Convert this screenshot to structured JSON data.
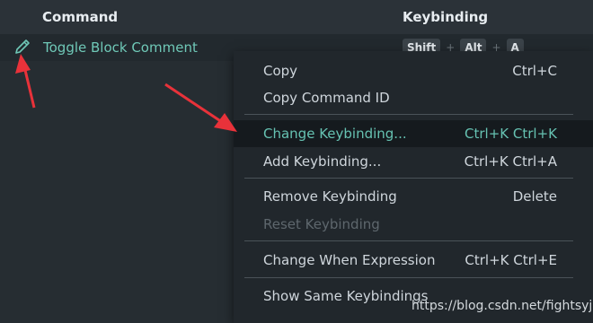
{
  "table": {
    "columns": {
      "command": "Command",
      "keybinding": "Keybinding"
    },
    "row": {
      "command": "Toggle Block Comment",
      "keys": [
        "Shift",
        "Alt",
        "A"
      ],
      "separator": "+"
    }
  },
  "context_menu": {
    "items": [
      {
        "label": "Copy",
        "shortcut": "Ctrl+C"
      },
      {
        "label": "Copy Command ID",
        "shortcut": ""
      },
      {
        "label": "Change Keybinding...",
        "shortcut": "Ctrl+K Ctrl+K",
        "highlighted": true
      },
      {
        "label": "Add Keybinding...",
        "shortcut": "Ctrl+K Ctrl+A"
      },
      {
        "label": "Remove Keybinding",
        "shortcut": "Delete"
      },
      {
        "label": "Reset Keybinding",
        "shortcut": "",
        "disabled": true
      },
      {
        "label": "Change When Expression",
        "shortcut": "Ctrl+K Ctrl+E"
      },
      {
        "label": "Show Same Keybindings",
        "shortcut": ""
      }
    ]
  },
  "icons": {
    "edit": "pencil-icon"
  },
  "watermark": "https://blog.csdn.net/fightsyj",
  "colors": {
    "accent": "#66c2b2",
    "annotation_arrow": "#e8323a"
  }
}
